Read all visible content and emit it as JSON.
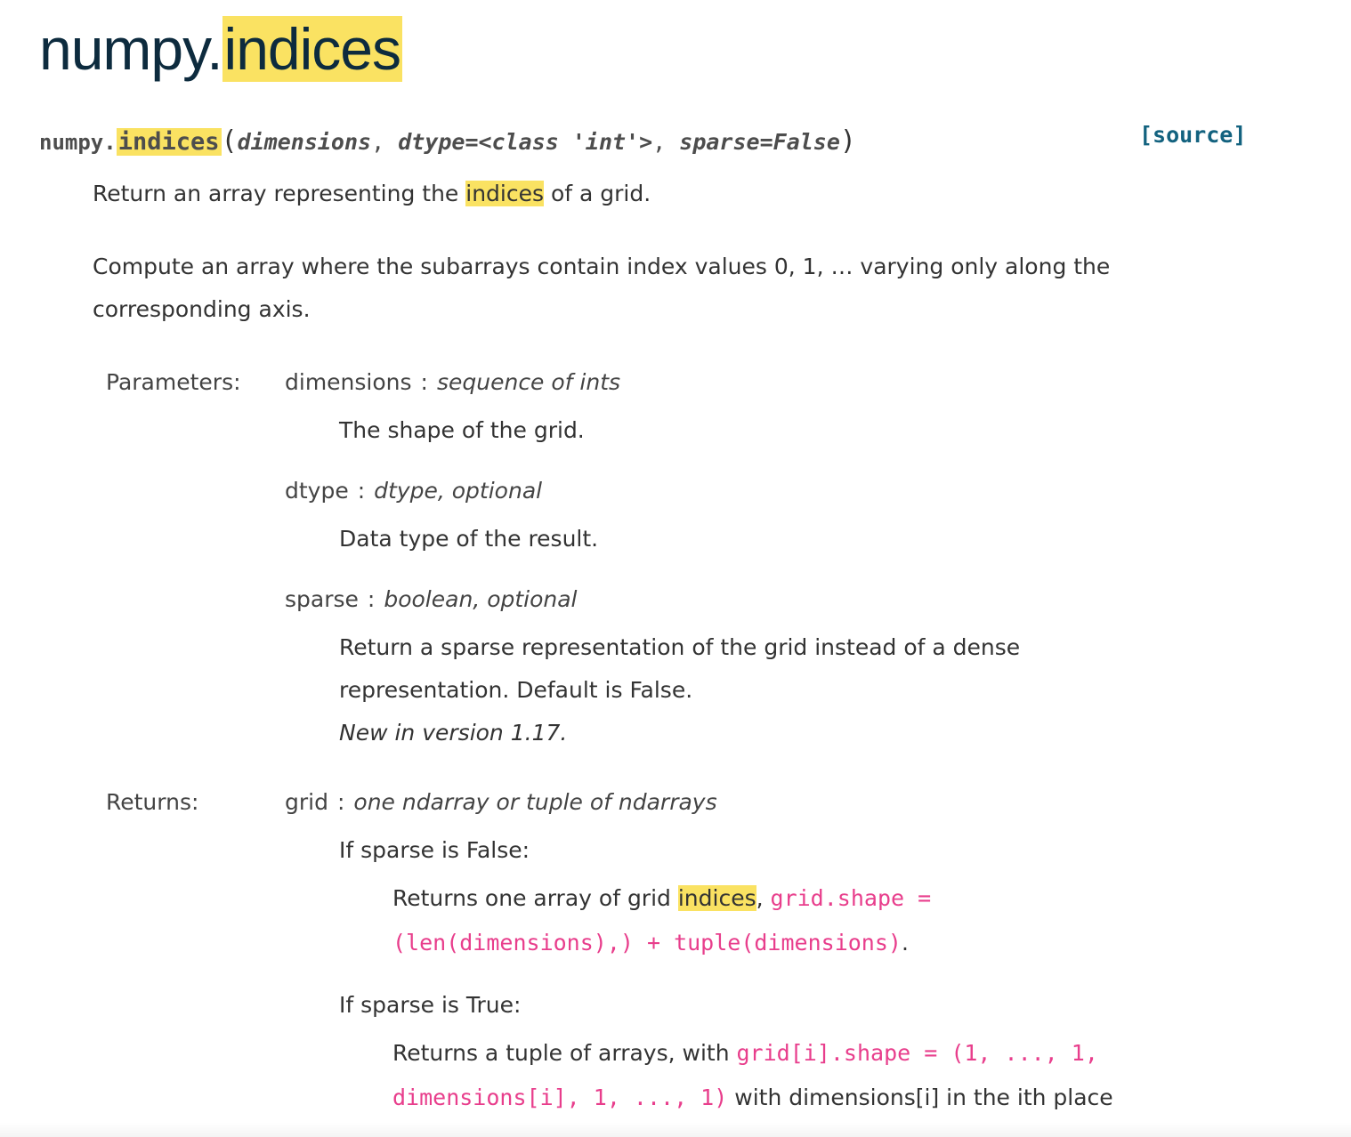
{
  "title": {
    "prefix": "numpy.",
    "name": "indices"
  },
  "signature": {
    "prefix": "numpy.",
    "name": "indices",
    "open_paren": "(",
    "params": [
      {
        "text": "dimensions"
      },
      {
        "text": "dtype=<class 'int'>"
      },
      {
        "text": "sparse=False"
      }
    ],
    "separator": ", ",
    "close_paren": ")",
    "source_label": "[source]"
  },
  "summary": {
    "before": "Return an array representing the ",
    "highlight": "indices",
    "after": " of a grid."
  },
  "description": "Compute an array where the subarrays contain index values 0, 1, … varying only along the corresponding axis.",
  "parameters": {
    "label": "Parameters:",
    "items": [
      {
        "name": "dimensions",
        "colon": ":",
        "type": "sequence of ints",
        "desc": "The shape of the grid."
      },
      {
        "name": "dtype",
        "colon": ":",
        "type": "dtype, optional",
        "desc": "Data type of the result."
      },
      {
        "name": "sparse",
        "colon": ":",
        "type": "boolean, optional",
        "desc": "Return a sparse representation of the grid instead of a dense representation. Default is False.",
        "version": "New in version 1.17."
      }
    ]
  },
  "returns": {
    "label": "Returns:",
    "name": "grid",
    "colon": ":",
    "type": "one ndarray or tuple of ndarrays",
    "cases": [
      {
        "heading": "If sparse is False:",
        "before": "Returns one array of grid ",
        "highlight": "indices",
        "comma": ",",
        "code": "grid.shape = (len(dimensions),) + tuple(dimensions)",
        "after": "."
      },
      {
        "heading": "If sparse is True:",
        "before": "Returns a tuple of arrays, with ",
        "code": "grid[i].shape = (1, ..., 1, dimensions[i], 1, ..., 1)",
        "after": " with dimensions[i] in the ith place"
      }
    ]
  }
}
